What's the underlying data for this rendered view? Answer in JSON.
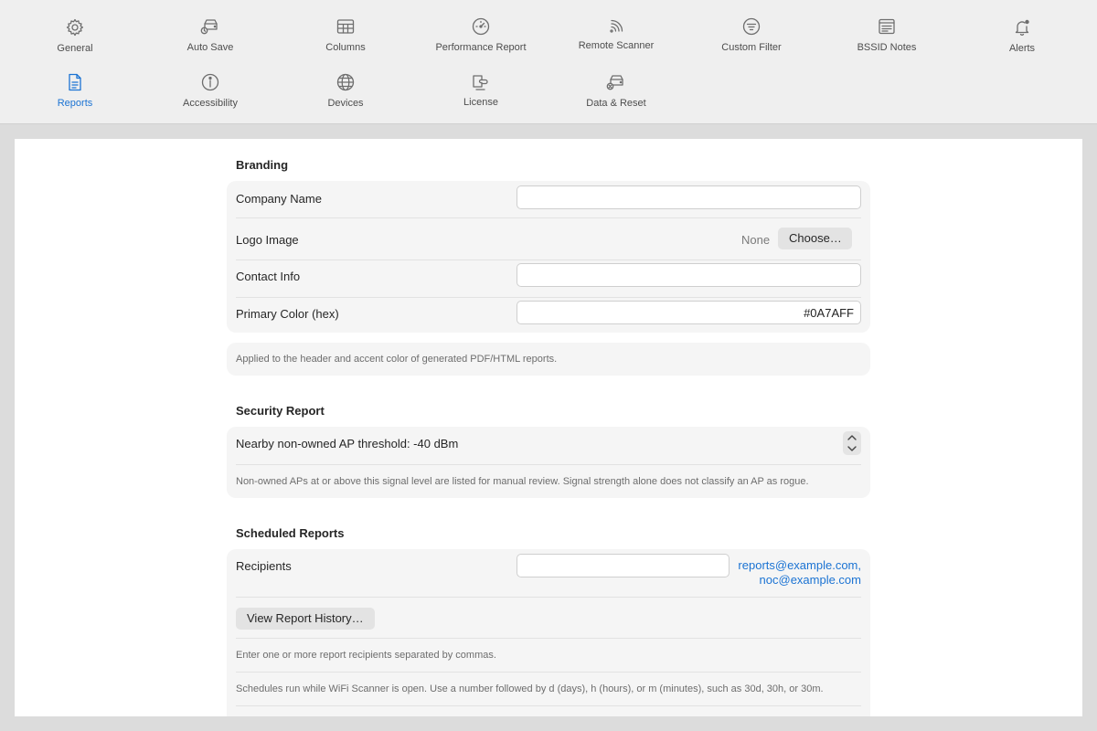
{
  "toolbar": {
    "items": [
      {
        "label": "General",
        "icon": "gear-icon"
      },
      {
        "label": "Auto Save",
        "icon": "drive-clock-icon"
      },
      {
        "label": "Columns",
        "icon": "table-icon"
      },
      {
        "label": "Performance Report",
        "icon": "gauge-icon"
      },
      {
        "label": "Remote Scanner",
        "icon": "antenna-icon"
      },
      {
        "label": "Custom Filter",
        "icon": "filter-icon"
      },
      {
        "label": "BSSID Notes",
        "icon": "notes-icon"
      },
      {
        "label": "Alerts",
        "icon": "bell-badge-icon"
      },
      {
        "label": "Reports",
        "icon": "document-icon"
      },
      {
        "label": "Accessibility",
        "icon": "accessibility-icon"
      },
      {
        "label": "Devices",
        "icon": "globe-icon"
      },
      {
        "label": "License",
        "icon": "license-icon"
      },
      {
        "label": "Data & Reset",
        "icon": "drive-reset-icon"
      }
    ],
    "active": "Reports",
    "active_color": "#1b73d3"
  },
  "branding": {
    "title": "Branding",
    "company_name_label": "Company Name",
    "company_name_value": "",
    "logo_label": "Logo Image",
    "logo_value": "None",
    "choose_button": "Choose…",
    "contact_label": "Contact Info",
    "contact_value": "",
    "color_label": "Primary Color (hex)",
    "color_value": "#0A7AFF",
    "note": "Applied to the header and accent color of generated PDF/HTML reports."
  },
  "security": {
    "title": "Security Report",
    "threshold_label": "Nearby non-owned AP threshold: -40 dBm",
    "note": "Non-owned APs at or above this signal level are listed for manual review. Signal strength alone does not classify an AP as rogue."
  },
  "scheduled": {
    "title": "Scheduled Reports",
    "recipients_label": "Recipients",
    "recipients_value": "",
    "recipient_links": [
      "reports@example.com,",
      "noc@example.com"
    ],
    "history_button": "View Report History…",
    "note1": "Enter one or more report recipients separated by commas.",
    "note2": "Schedules run while WiFi Scanner is open. Use a number followed by d (days), h (hours), or m (minutes), such as 30d, 30h, or 30m."
  }
}
